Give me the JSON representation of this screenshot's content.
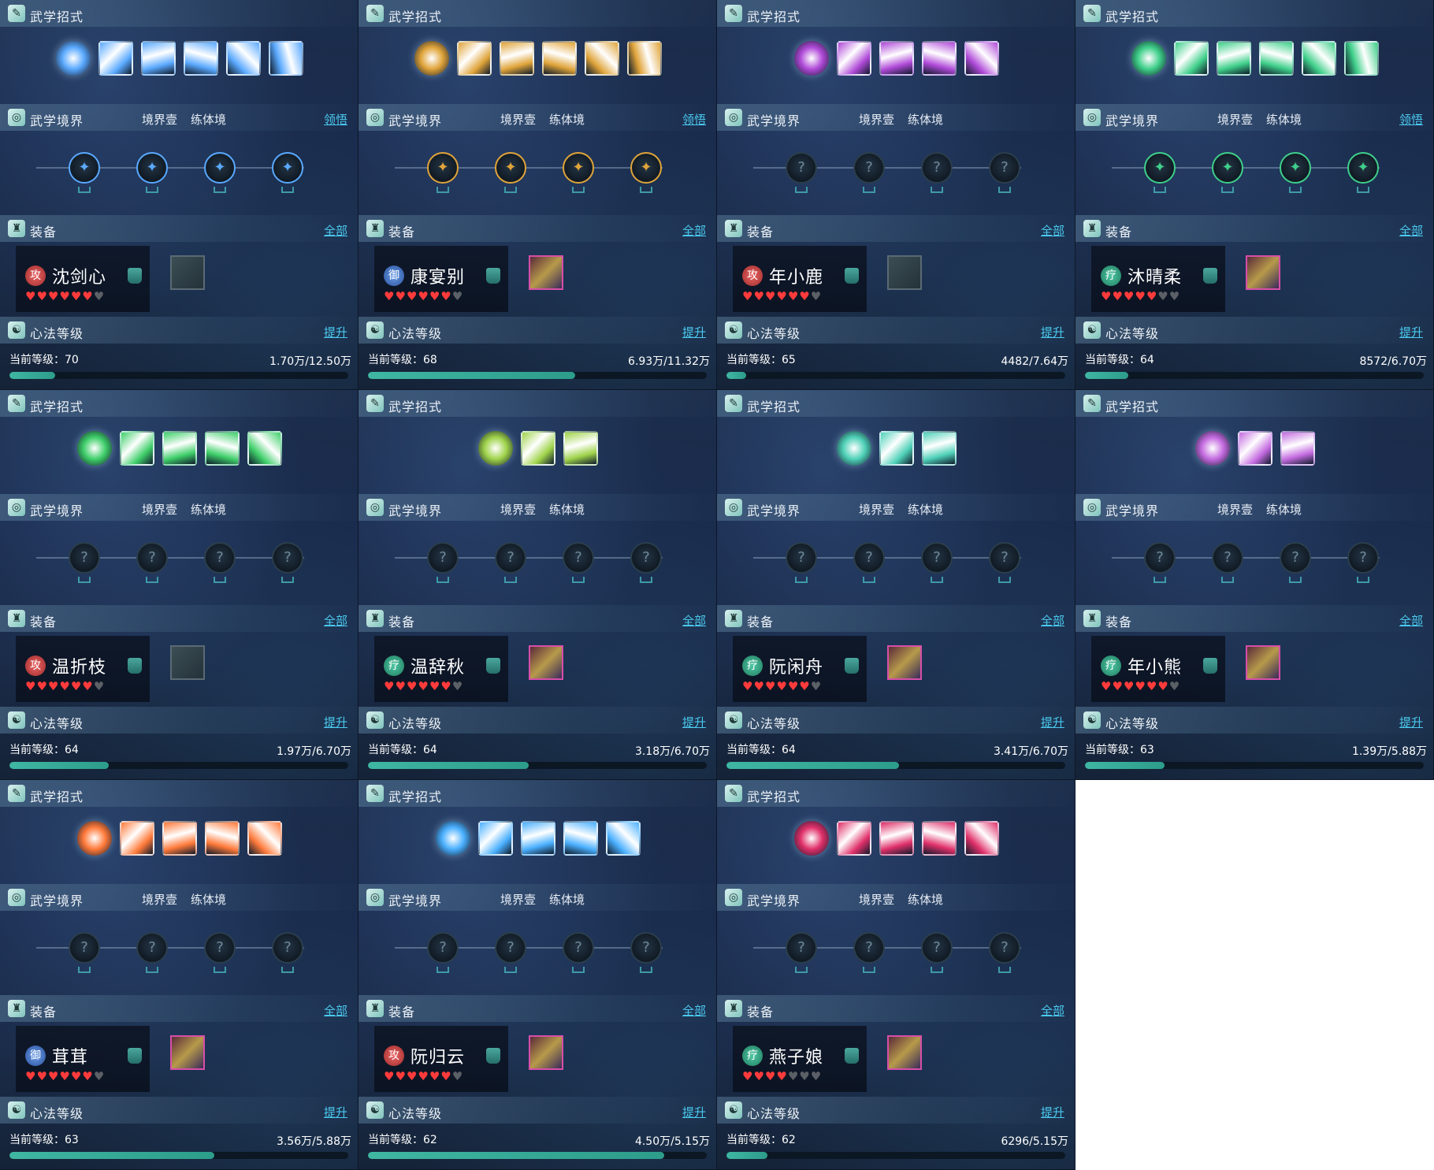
{
  "labels": {
    "skills_title": "武学招式",
    "realm_title": "武学境界",
    "realm_stage": "境界壹",
    "realm_type": "练体境",
    "realm_link": "领悟",
    "equip_title": "装备",
    "equip_link": "全部",
    "heart_title": "心法等级",
    "heart_link": "提升",
    "level_prefix": "当前等级："
  },
  "colors": {
    "accent_link": "#4ac9ee",
    "exp_bar": "#3fb7a3",
    "heart": "#ff3b3b"
  },
  "panels": [
    {
      "name": "沈剑心",
      "role": "攻",
      "role_type": "atk",
      "hearts": 6,
      "level": "70",
      "exp": "1.70万/12.50万",
      "progress": 0.136,
      "realm_link_visible": true,
      "skill_count": 5,
      "realm_nodes_unlocked": true,
      "equip_slot": "empty",
      "theme": "#5aa9ff"
    },
    {
      "name": "康宴别",
      "role": "御",
      "role_type": "def",
      "hearts": 6,
      "level": "68",
      "exp": "6.93万/11.32万",
      "progress": 0.612,
      "realm_link_visible": true,
      "skill_count": 5,
      "realm_nodes_unlocked": true,
      "equip_slot": "filled",
      "theme": "#e0a43a"
    },
    {
      "name": "年小鹿",
      "role": "攻",
      "role_type": "atk",
      "hearts": 6,
      "level": "65",
      "exp": "4482/7.64万",
      "progress": 0.059,
      "realm_link_visible": false,
      "skill_count": 4,
      "realm_nodes_unlocked": false,
      "equip_slot": "empty",
      "theme": "#b04ad8"
    },
    {
      "name": "沐晴柔",
      "role": "疗",
      "role_type": "sup",
      "hearts": 5,
      "level": "64",
      "exp": "8572/6.70万",
      "progress": 0.128,
      "realm_link_visible": true,
      "skill_count": 5,
      "realm_nodes_unlocked": true,
      "equip_slot": "filled",
      "theme": "#3fcf8a"
    },
    {
      "name": "温折枝",
      "role": "攻",
      "role_type": "atk",
      "hearts": 6,
      "level": "64",
      "exp": "1.97万/6.70万",
      "progress": 0.294,
      "realm_link_visible": false,
      "skill_count": 4,
      "realm_nodes_unlocked": false,
      "equip_slot": "empty",
      "theme": "#3fcf6a"
    },
    {
      "name": "温辞秋",
      "role": "疗",
      "role_type": "sup",
      "hearts": 6,
      "level": "64",
      "exp": "3.18万/6.70万",
      "progress": 0.475,
      "realm_link_visible": false,
      "skill_count": 2,
      "realm_nodes_unlocked": false,
      "equip_slot": "filled",
      "theme": "#9fd34a"
    },
    {
      "name": "阮闲舟",
      "role": "疗",
      "role_type": "sup",
      "hearts": 6,
      "level": "64",
      "exp": "3.41万/6.70万",
      "progress": 0.509,
      "realm_link_visible": false,
      "skill_count": 2,
      "realm_nodes_unlocked": false,
      "equip_slot": "filled",
      "theme": "#4fd1b8"
    },
    {
      "name": "年小熊",
      "role": "疗",
      "role_type": "sup",
      "hearts": 6,
      "level": "63",
      "exp": "1.39万/5.88万",
      "progress": 0.236,
      "realm_link_visible": false,
      "skill_count": 2,
      "realm_nodes_unlocked": false,
      "equip_slot": "filled",
      "theme": "#c46be0"
    },
    {
      "name": "茸茸",
      "role": "御",
      "role_type": "def",
      "hearts": 6,
      "level": "63",
      "exp": "3.56万/5.88万",
      "progress": 0.605,
      "realm_link_visible": false,
      "skill_count": 4,
      "realm_nodes_unlocked": false,
      "equip_slot": "filled",
      "theme": "#ff7a3a"
    },
    {
      "name": "阮归云",
      "role": "攻",
      "role_type": "atk",
      "hearts": 6,
      "level": "62",
      "exp": "4.50万/5.15万",
      "progress": 0.874,
      "realm_link_visible": false,
      "skill_count": 4,
      "realm_nodes_unlocked": false,
      "equip_slot": "filled",
      "theme": "#4ab0ff"
    },
    {
      "name": "燕子娘",
      "role": "疗",
      "role_type": "sup",
      "hearts": 4,
      "level": "62",
      "exp": "6296/5.15万",
      "progress": 0.122,
      "realm_link_visible": false,
      "skill_count": 4,
      "realm_nodes_unlocked": false,
      "equip_slot": "filled",
      "theme": "#e0306a"
    }
  ]
}
